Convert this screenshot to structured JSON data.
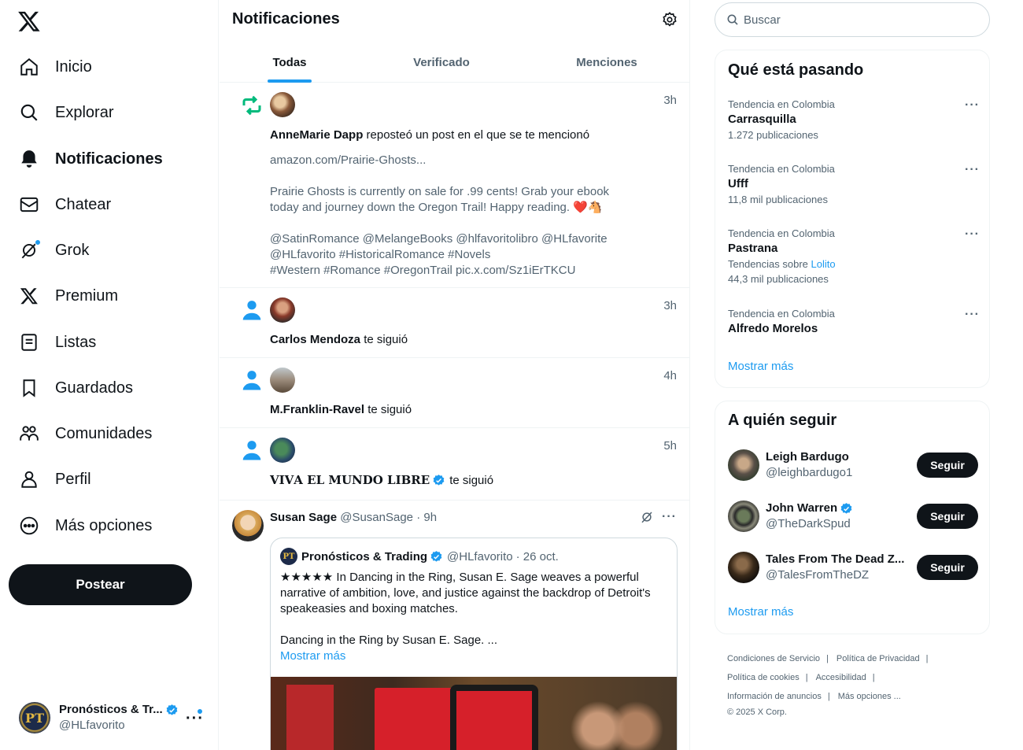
{
  "sidebar": {
    "items": [
      {
        "label": "Inicio",
        "icon": "home-icon"
      },
      {
        "label": "Explorar",
        "icon": "search-icon"
      },
      {
        "label": "Notificaciones",
        "icon": "bell-icon"
      },
      {
        "label": "Chatear",
        "icon": "mail-icon"
      },
      {
        "label": "Grok",
        "icon": "grok-icon"
      },
      {
        "label": "Premium",
        "icon": "x-icon"
      },
      {
        "label": "Listas",
        "icon": "list-icon"
      },
      {
        "label": "Guardados",
        "icon": "bookmark-icon"
      },
      {
        "label": "Comunidades",
        "icon": "people-icon"
      },
      {
        "label": "Perfil",
        "icon": "person-icon"
      },
      {
        "label": "Más opciones",
        "icon": "more-circle-icon"
      }
    ],
    "post_button": "Postear",
    "account": {
      "name": "Pronósticos & Tr...",
      "handle": "@HLfavorito",
      "avatar_text": "PT"
    }
  },
  "main": {
    "title": "Notificaciones",
    "tabs": [
      {
        "label": "Todas"
      },
      {
        "label": "Verificado"
      },
      {
        "label": "Menciones"
      }
    ],
    "notifications": [
      {
        "type": "repost",
        "time": "3h",
        "user": "AnneMarie Dapp",
        "action": "reposteó un post en el que se te mencionó",
        "body": [
          "amazon.com/Prairie-Ghosts...",
          "",
          "Prairie Ghosts is currently on sale for .99 cents! Grab your ebook",
          "today and journey down the Oregon Trail! Happy reading. ❤️🐴",
          "",
          "@SatinRomance @MelangeBooks @hlfavoritolibro @HLfavorite",
          "@HLfavorito #HistoricalRomance #Novels",
          "#Western #Romance #OregonTrail pic.x.com/Sz1iErTKCU"
        ]
      },
      {
        "type": "follow",
        "time": "3h",
        "user": "Carlos Mendoza",
        "action": "te siguió"
      },
      {
        "type": "follow",
        "time": "4h",
        "user": "M.Franklin-Ravel",
        "action": "te siguió"
      },
      {
        "type": "follow",
        "time": "5h",
        "user": "𝐕𝐈𝐕𝐀 𝐄𝐋 𝐌𝐔𝐍𝐃𝐎 𝐋𝐈𝐁𝐑𝐄",
        "action": "te siguió"
      }
    ],
    "tweet": {
      "name": "Susan Sage",
      "handle": "@SusanSage",
      "time": "· 9h",
      "quote": {
        "name": "Pronósticos & Trading",
        "handle": "@HLfavorito",
        "date": "· 26 oct.",
        "text_lines": [
          "★★★★★ In Dancing in the Ring, Susan E. Sage weaves a powerful",
          "narrative of ambition, love, and justice against the backdrop of Detroit's",
          "speakeasies and boxing matches.",
          "",
          "Dancing in the Ring by Susan E. Sage. ..."
        ],
        "more": "Mostrar más"
      }
    }
  },
  "right": {
    "search": {
      "placeholder": "Buscar"
    },
    "trends_title": "Qué está pasando",
    "trends": [
      {
        "context": "Tendencia en Colombia",
        "name": "Carrasquilla",
        "count": "1.272 publicaciones"
      },
      {
        "context": "Tendencia en Colombia",
        "name": "Ufff",
        "count": "11,8 mil publicaciones"
      },
      {
        "context": "Tendencia en Colombia",
        "name": "Pastrana",
        "about_prefix": "Tendencias sobre",
        "about_link": "Lolito",
        "count": "44,3 mil publicaciones"
      },
      {
        "context": "Tendencia en Colombia",
        "name": "Alfredo Morelos",
        "count": ""
      }
    ],
    "trends_more": "Mostrar más",
    "who_title": "A quién seguir",
    "who": [
      {
        "name": "Leigh Bardugo",
        "handle": "@leighbardugo1",
        "button": "Seguir"
      },
      {
        "name": "John Warren",
        "handle": "@TheDarkSpud",
        "button": "Seguir"
      },
      {
        "name": "Tales From The Dead Z...",
        "handle": "@TalesFromTheDZ",
        "button": "Seguir"
      }
    ],
    "who_more": "Mostrar más",
    "footer": [
      "Condiciones de Servicio",
      "Política de Privacidad",
      "Política de cookies",
      "Accesibilidad",
      "Información de anuncios",
      "Más opciones ...",
      "© 2025 X Corp."
    ]
  },
  "colors": {
    "accent": "#1d9bf0",
    "text": "#0f1419",
    "muted": "#536471",
    "repost": "#00ba7c"
  }
}
